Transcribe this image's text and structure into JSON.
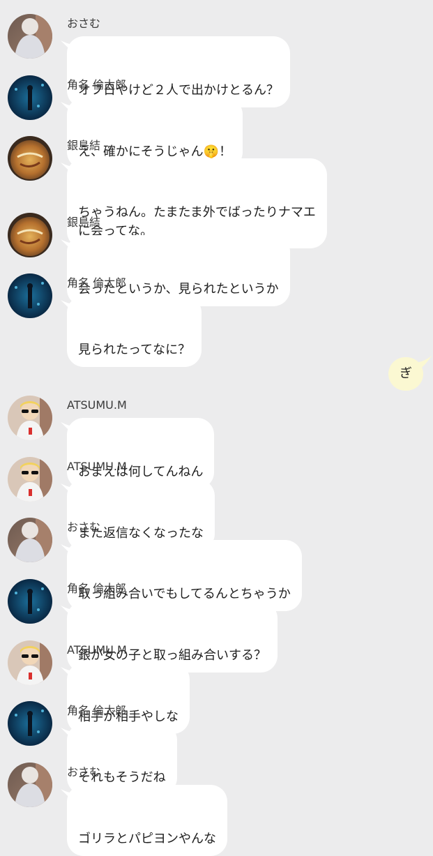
{
  "colors": {
    "background": "#ececed",
    "incoming_bubble": "#ffffff",
    "outgoing_bubble": "#fbf8d2"
  },
  "messages": [
    {
      "sender": "おさむ",
      "avatar": "osamu-avatar",
      "text": "オフ日やけど２人で出かけとるん？"
    },
    {
      "sender": "角名 倫太郎",
      "avatar": "suna-avatar",
      "text": "え、確かにそうじゃん",
      "emoji": "🤫",
      "text_after": "！"
    },
    {
      "sender": "銀島結",
      "avatar": "gin-avatar",
      "text": "ちゃうねん。たまたま外でばったりナマエ\nに会ってな。"
    },
    {
      "sender": "銀島結",
      "avatar": "gin-avatar",
      "text": "会ったというか、見られたというか"
    },
    {
      "sender": "角名 倫太郎",
      "avatar": "suna-avatar",
      "text": "見られたってなに？"
    },
    {
      "sender": "ATSUMU.M",
      "avatar": "atsumu-avatar",
      "text": "おまえは何してんねん"
    },
    {
      "sender": "ATSUMU.M",
      "avatar": "atsumu-avatar",
      "text": "また返信なくなったな"
    },
    {
      "sender": "おさむ",
      "avatar": "osamu-avatar",
      "text": "取っ組み合いでもしてるんとちゃうか"
    },
    {
      "sender": "角名 倫太郎",
      "avatar": "suna-avatar",
      "text": "銀が女の子と取っ組み合いする？"
    },
    {
      "sender": "ATSUMU.M",
      "avatar": "atsumu-avatar",
      "text": "相手が相手やしな"
    },
    {
      "sender": "角名 倫太郎",
      "avatar": "suna-avatar",
      "text": "それもそうだね"
    },
    {
      "sender": "おさむ",
      "avatar": "osamu-avatar",
      "text": "ゴリラとパピヨンやんな"
    }
  ],
  "outgoing": {
    "text": "ぎ"
  }
}
